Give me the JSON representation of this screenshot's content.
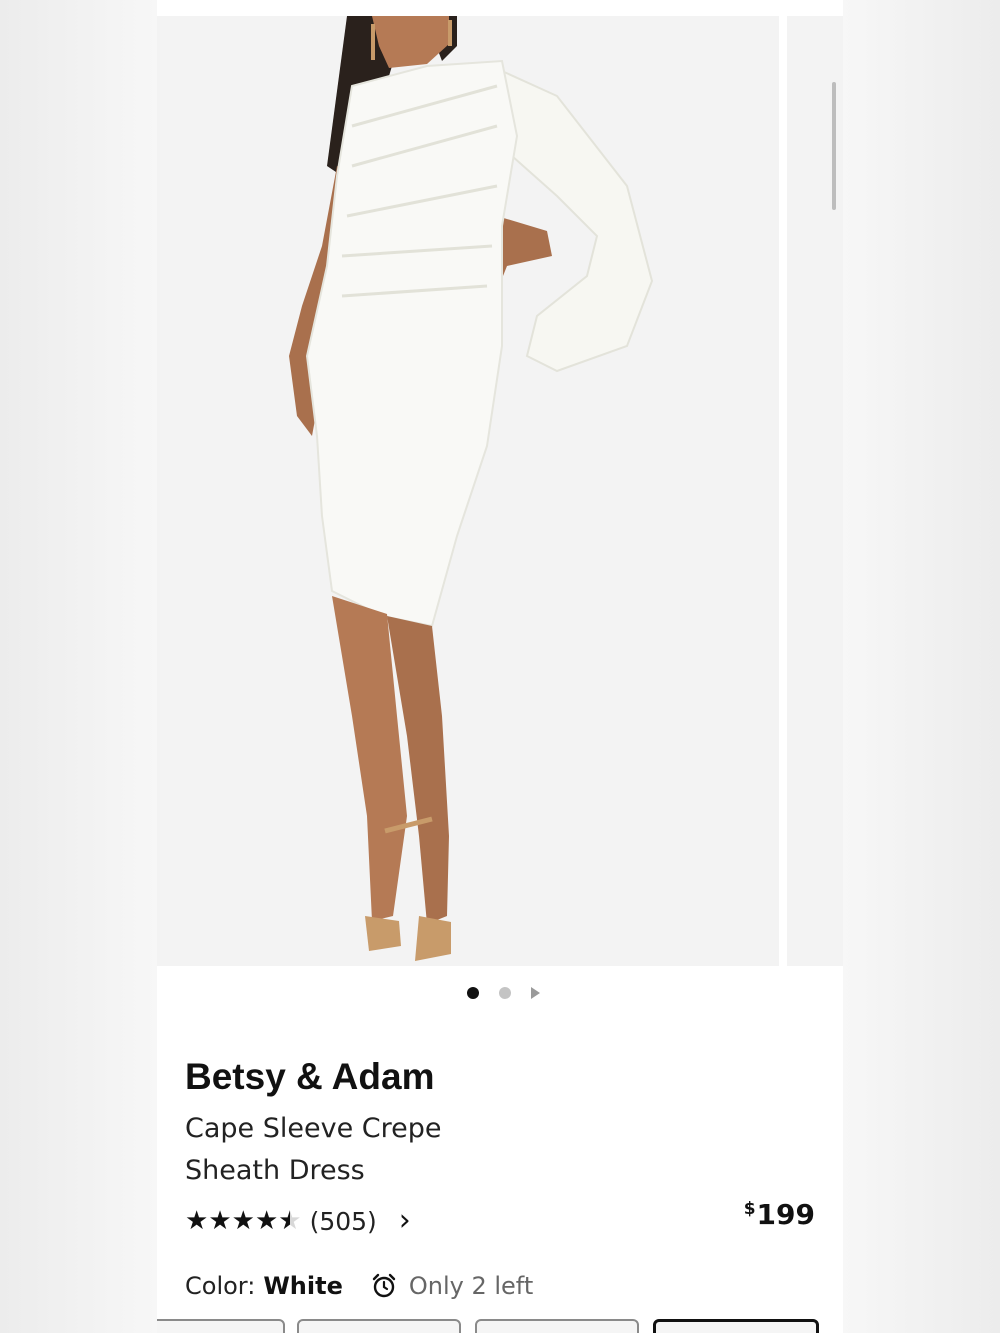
{
  "product": {
    "brand": "Betsy & Adam",
    "name_line1": "Cape Sleeve Crepe",
    "name_line2": "Sheath Dress",
    "rating": 4.5,
    "review_count": "(505)",
    "price_currency": "$",
    "price_amount": "199"
  },
  "carousel": {
    "current_index": 0,
    "total_dots": 2,
    "has_video_indicator": true
  },
  "color": {
    "label": "Color:",
    "value": "White"
  },
  "stock": {
    "text": "Only 2 left",
    "icon": "alarm-clock-icon"
  },
  "swatches": {
    "count": 4,
    "selected_index": 3
  },
  "colors": {
    "background": "#ffffff",
    "text": "#111111",
    "muted": "#666666",
    "dot_inactive": "#c4c4c4"
  }
}
